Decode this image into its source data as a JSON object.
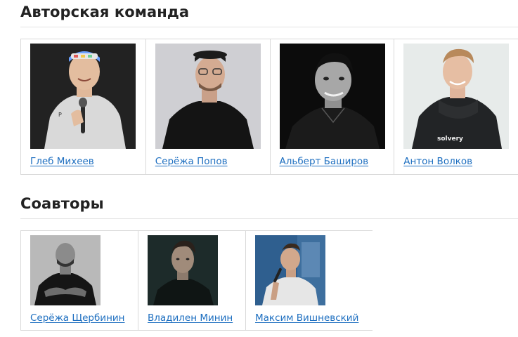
{
  "sections": {
    "team": {
      "title": "Авторская команда",
      "members": [
        {
          "name": "Глеб Михеев"
        },
        {
          "name": "Серёжа Попов"
        },
        {
          "name": "Альберт Баширов"
        },
        {
          "name": "Антон Волков",
          "shirt_text": "solvery"
        }
      ]
    },
    "coauthors": {
      "title": "Соавторы",
      "members": [
        {
          "name": "Серёжа Щербинин"
        },
        {
          "name": "Владилен Минин"
        },
        {
          "name": "Максим Вишневский"
        }
      ]
    }
  },
  "colors": {
    "link": "#1e6fc0",
    "border": "#d9d9d9",
    "heading": "#222222"
  }
}
